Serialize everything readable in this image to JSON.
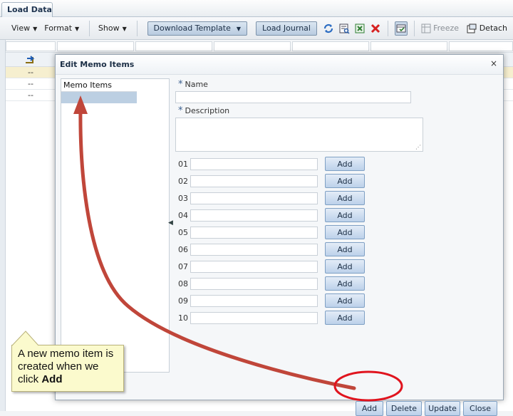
{
  "app": {
    "tab_label": "Load Data"
  },
  "toolbar": {
    "view_label": "View",
    "format_label": "Format",
    "show_label": "Show",
    "download_template_label": "Download Template",
    "load_journal_label": "Load Journal",
    "freeze_label": "Freeze",
    "detach_label": "Detach"
  },
  "grid": {
    "rows": [
      "--",
      "--",
      "--"
    ]
  },
  "dialog": {
    "title": "Edit Memo Items",
    "close_glyph": "×",
    "list_header": "Memo Items",
    "name_label": "Name",
    "description_label": "Description",
    "required_marker": "*",
    "memo_rows": [
      {
        "num": "01",
        "button": "Add"
      },
      {
        "num": "02",
        "button": "Add"
      },
      {
        "num": "03",
        "button": "Add"
      },
      {
        "num": "04",
        "button": "Add"
      },
      {
        "num": "05",
        "button": "Add"
      },
      {
        "num": "06",
        "button": "Add"
      },
      {
        "num": "07",
        "button": "Add"
      },
      {
        "num": "08",
        "button": "Add"
      },
      {
        "num": "09",
        "button": "Add"
      },
      {
        "num": "10",
        "button": "Add"
      }
    ],
    "footer": {
      "add_label": "Add",
      "delete_label": "Delete",
      "update_label": "Update",
      "close_label": "Close"
    }
  },
  "annotation": {
    "text_part1": "A new memo item is created when we click ",
    "text_bold": "Add"
  },
  "colors": {
    "annotation_arrow": "#c0463a",
    "highlight_circle": "#e0141e"
  }
}
